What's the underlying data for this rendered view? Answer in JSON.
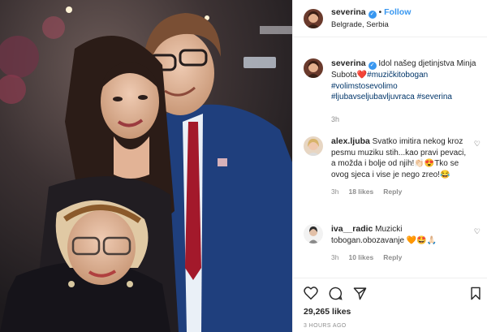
{
  "post": {
    "username": "severina",
    "follow_label": "Follow",
    "separator": "•",
    "location": "Belgrade, Serbia"
  },
  "caption": {
    "username": "severina",
    "text": " Idol našeg djetinjstva Minja Subota",
    "heart_emoji": "❤️",
    "tags": [
      "#muzičkitobogan",
      "#volimstosevolimo",
      "#ljubavseljubavljuvraca",
      "#severina"
    ],
    "time": "3h"
  },
  "comments": [
    {
      "username": "alex.ljuba",
      "text": " Svatko imitira nekog kroz pesmu muziku stih...kao pravi pevaci, a možda i bolje od njih!👏🏻😍Tko se ovog sjeca i vise je nego zreo!😂",
      "time": "3h",
      "likes": "18 likes",
      "reply_label": "Reply"
    },
    {
      "username": "iva__radic",
      "text": " Muzicki tobogan.obozavanje 🧡🤩🙏🏻",
      "time": "3h",
      "likes": "10 likes",
      "reply_label": "Reply"
    }
  ],
  "stats": {
    "likes": "29,265 likes",
    "posted": "3 HOURS AGO"
  },
  "icons": [
    "heart-icon",
    "comment-icon",
    "share-icon",
    "bookmark-icon",
    "verified-badge-icon"
  ],
  "colors": {
    "link": "#3897f0",
    "hashtag": "#003569",
    "muted": "#8e8e8e"
  }
}
